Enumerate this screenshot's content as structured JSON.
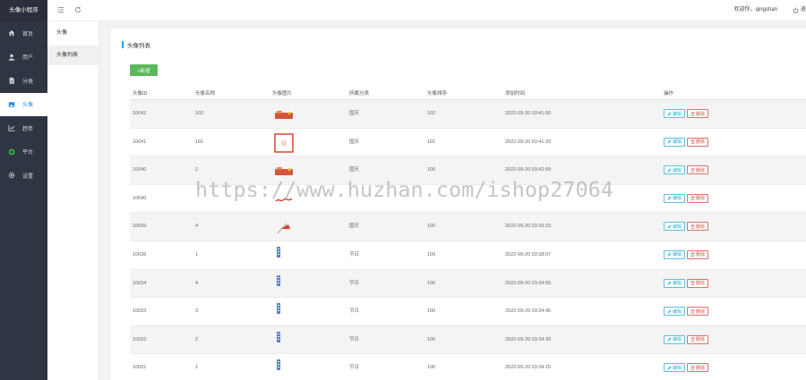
{
  "app": {
    "title": "头像小程序"
  },
  "sidebar": {
    "items": [
      {
        "label": "首页",
        "icon": "home-icon",
        "active": false
      },
      {
        "label": "用户",
        "icon": "user-icon",
        "active": false
      },
      {
        "label": "分类",
        "icon": "file-icon",
        "active": false
      },
      {
        "label": "头像",
        "icon": "image-icon",
        "active": true
      },
      {
        "label": "趋势",
        "icon": "chart-icon",
        "active": false
      },
      {
        "label": "平台",
        "icon": "platform-icon",
        "active": false
      },
      {
        "label": "设置",
        "icon": "gear-icon",
        "active": false
      }
    ]
  },
  "submenu": {
    "title": "头像",
    "items": [
      {
        "label": "头像列表"
      }
    ]
  },
  "topbar": {
    "welcome": "欢迎你，qingshan",
    "logout": "退"
  },
  "main": {
    "title": "头像列表",
    "add_label": "+新增",
    "columns": [
      "头像ID",
      "头像名称",
      "头像图片",
      "所属分类",
      "头像排序",
      "添加时间",
      "操作"
    ],
    "edit_label": "编辑",
    "delete_label": "删除",
    "rows": [
      {
        "id": "10042",
        "name": "102",
        "category": "国庆",
        "sort": "102",
        "time": "2022-09-20 03:41:50",
        "thumb": "banner"
      },
      {
        "id": "10041",
        "name": "101",
        "category": "国庆",
        "sort": "101",
        "time": "2022-09-20 03:41:33",
        "thumb": "frame"
      },
      {
        "id": "10040",
        "name": "2",
        "category": "国庆",
        "sort": "100",
        "time": "2022-09-20 03:42:09",
        "thumb": "banner"
      },
      {
        "id": "10040",
        "name": "",
        "category": "",
        "sort": "",
        "time": "",
        "thumb": "script"
      },
      {
        "id": "10039",
        "name": "4",
        "category": "国庆",
        "sort": "100",
        "time": "2022-09-20 03:39:23",
        "thumb": "flag"
      },
      {
        "id": "10036",
        "name": "1",
        "category": "节日",
        "sort": "100",
        "time": "2022-09-20 03:38:07",
        "thumb": "tag"
      },
      {
        "id": "10034",
        "name": "4",
        "category": "节日",
        "sort": "100",
        "time": "2022-09-20 03:34:56",
        "thumb": "tag"
      },
      {
        "id": "10033",
        "name": "3",
        "category": "节日",
        "sort": "100",
        "time": "2022-09-20 03:34:45",
        "thumb": "tag"
      },
      {
        "id": "10032",
        "name": "2",
        "category": "节日",
        "sort": "100",
        "time": "2022-09-20 03:34:30",
        "thumb": "tag"
      },
      {
        "id": "10031",
        "name": "1",
        "category": "节日",
        "sort": "100",
        "time": "2022-09-20 03:34:15",
        "thumb": "tag"
      }
    ]
  },
  "watermark": "https://www.huzhan.com/ishop27064",
  "colors": {
    "sidebar": "#2f3542",
    "accent": "#1e9fff",
    "add_button": "#5cb85c",
    "edit": "#31b0d5",
    "delete": "#d9534f"
  }
}
